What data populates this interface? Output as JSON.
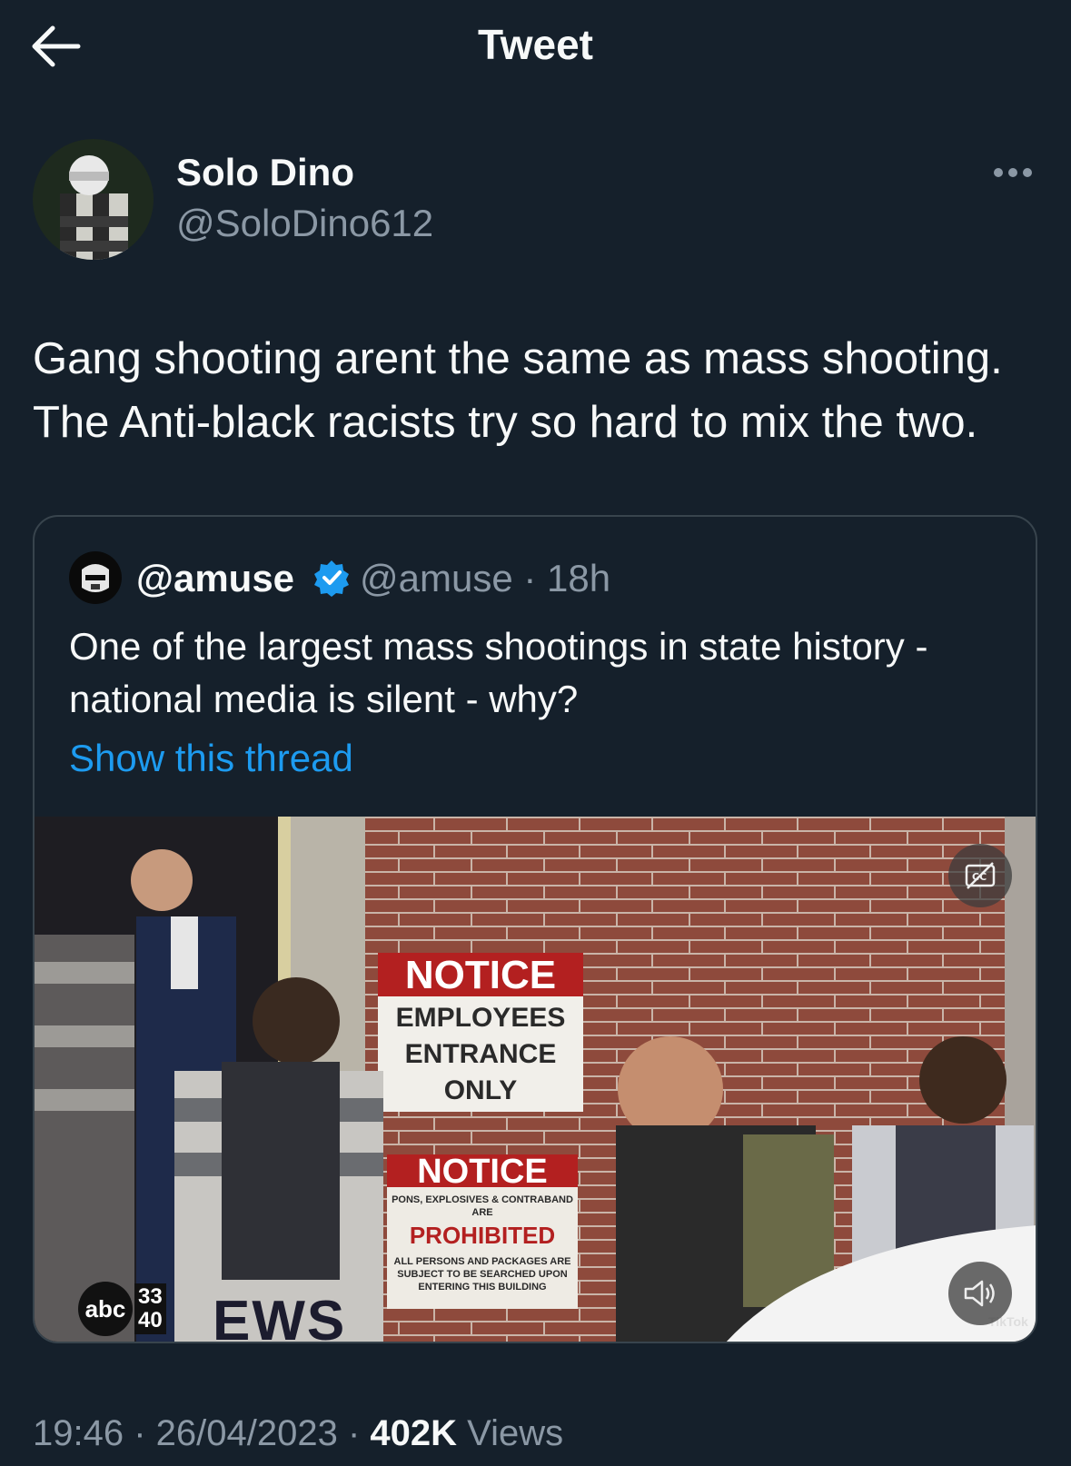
{
  "header": {
    "title": "Tweet",
    "back_icon": "arrow-left-icon"
  },
  "tweet": {
    "display_name": "Solo Dino",
    "handle": "@SoloDino612",
    "text_lines": [
      "Gang shooting arent the same as mass shooting.",
      "The Anti-black racists try so hard to mix the two."
    ],
    "timestamp": "19:46 · 26/04/2023 · ",
    "views_count": "402K",
    "views_label": " Views"
  },
  "quote": {
    "display_name": "@amuse",
    "handle_time": "@amuse · 18h",
    "text_lines": [
      "One of the largest mass shootings in state history -",
      "national media is silent - why?"
    ],
    "show_thread": "Show this thread",
    "media": {
      "sign1_title": "NOTICE",
      "sign1_l1": "EMPLOYEES",
      "sign1_l2": "ENTRANCE",
      "sign1_l3": "ONLY",
      "sign2_title": "NOTICE",
      "sign2_l1": "PONS, EXPLOSIVES & CONTRABAND",
      "sign2_l2": "ARE",
      "sign2_l3": "PROHIBITED",
      "sign2_l4": "ALL PERSONS AND PACKAGES ARE",
      "sign2_l5": "SUBJECT TO BE SEARCHED UPON",
      "sign2_l6": "ENTERING THIS BUILDING",
      "abc": "abc",
      "channel": "33\n40",
      "news": "EWS",
      "watermark": "TikTok"
    }
  },
  "colors": {
    "background": "#15202b",
    "secondary_text": "#8b98a5",
    "link": "#1d9bf0",
    "border": "#38444d"
  }
}
